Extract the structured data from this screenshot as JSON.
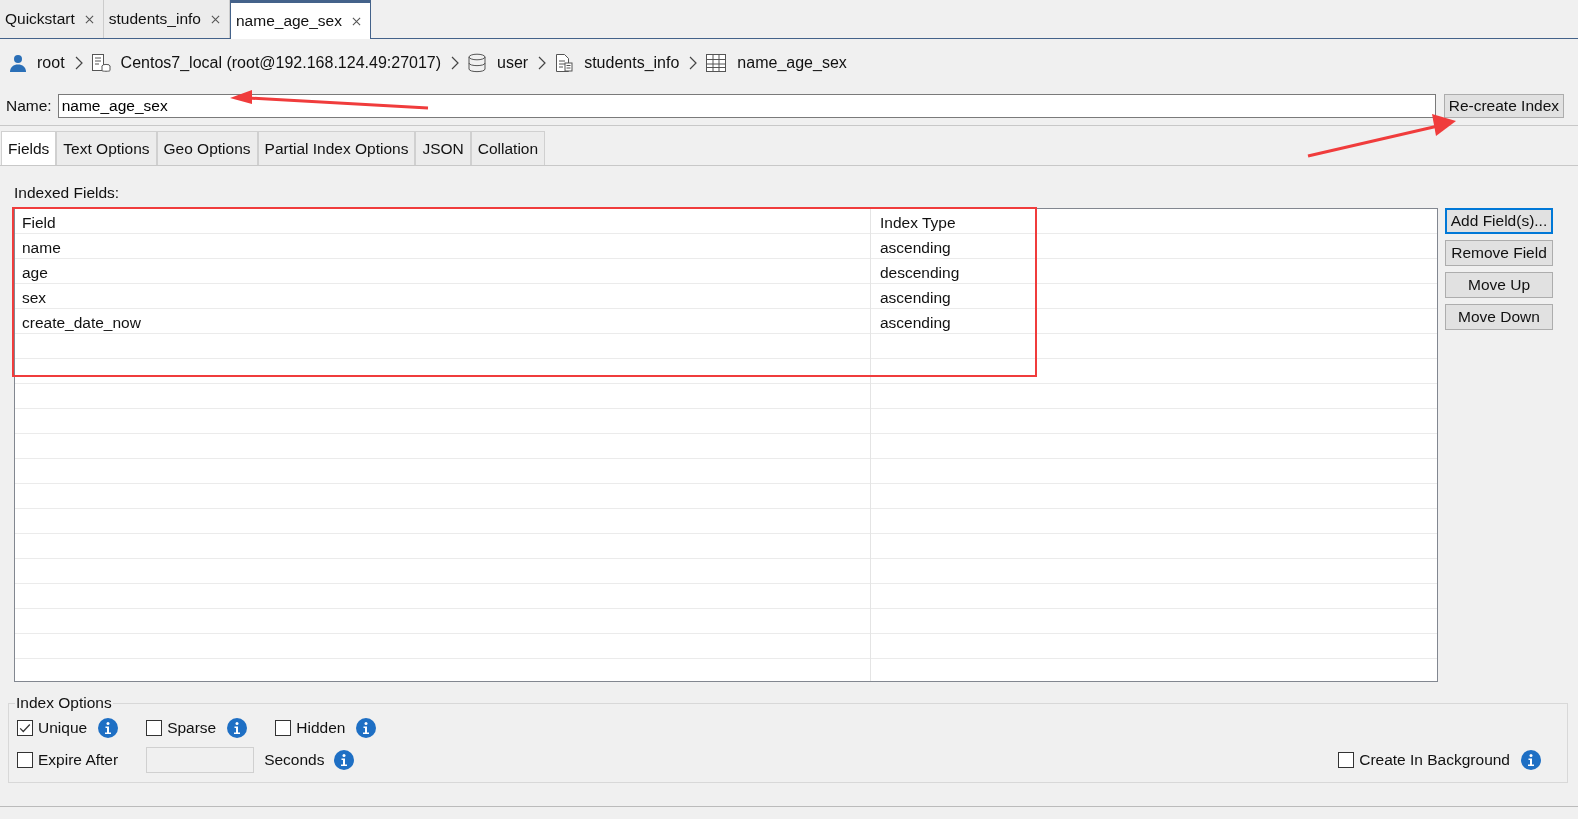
{
  "editor_tabs": [
    {
      "label": "Quickstart",
      "selected": false
    },
    {
      "label": "students_info",
      "selected": false
    },
    {
      "label": "name_age_sex",
      "selected": true
    }
  ],
  "breadcrumb": [
    {
      "kind": "user",
      "label": "root"
    },
    {
      "kind": "server",
      "label": "Centos7_local (root@192.168.124.49:27017)"
    },
    {
      "kind": "database",
      "label": "user"
    },
    {
      "kind": "collection",
      "label": "students_info"
    },
    {
      "kind": "index",
      "label": "name_age_sex"
    }
  ],
  "name_field": {
    "label": "Name:",
    "value": "name_age_sex"
  },
  "recreate_button": "Re-create Index",
  "option_tabs": [
    {
      "label": "Fields",
      "selected": true
    },
    {
      "label": "Text Options",
      "selected": false
    },
    {
      "label": "Geo Options",
      "selected": false
    },
    {
      "label": "Partial Index Options",
      "selected": false
    },
    {
      "label": "JSON",
      "selected": false
    },
    {
      "label": "Collation",
      "selected": false
    }
  ],
  "indexed_fields": {
    "label": "Indexed Fields:",
    "columns": [
      "Field",
      "Index Type"
    ],
    "rows": [
      [
        "name",
        "ascending"
      ],
      [
        "age",
        "descending"
      ],
      [
        "sex",
        "ascending"
      ],
      [
        "create_date_now",
        "ascending"
      ]
    ]
  },
  "side_buttons": [
    {
      "label": "Add Field(s)...",
      "focused": true
    },
    {
      "label": "Remove Field",
      "focused": false
    },
    {
      "label": "Move Up",
      "focused": false
    },
    {
      "label": "Move Down",
      "focused": false
    }
  ],
  "index_options": {
    "title": "Index Options",
    "flags": [
      {
        "label": "Unique",
        "checked": true
      },
      {
        "label": "Sparse",
        "checked": false
      },
      {
        "label": "Hidden",
        "checked": false
      }
    ],
    "expire": {
      "label": "Expire After",
      "checked": false,
      "unit": "Seconds"
    },
    "background": {
      "label": "Create In Background",
      "checked": false
    }
  }
}
